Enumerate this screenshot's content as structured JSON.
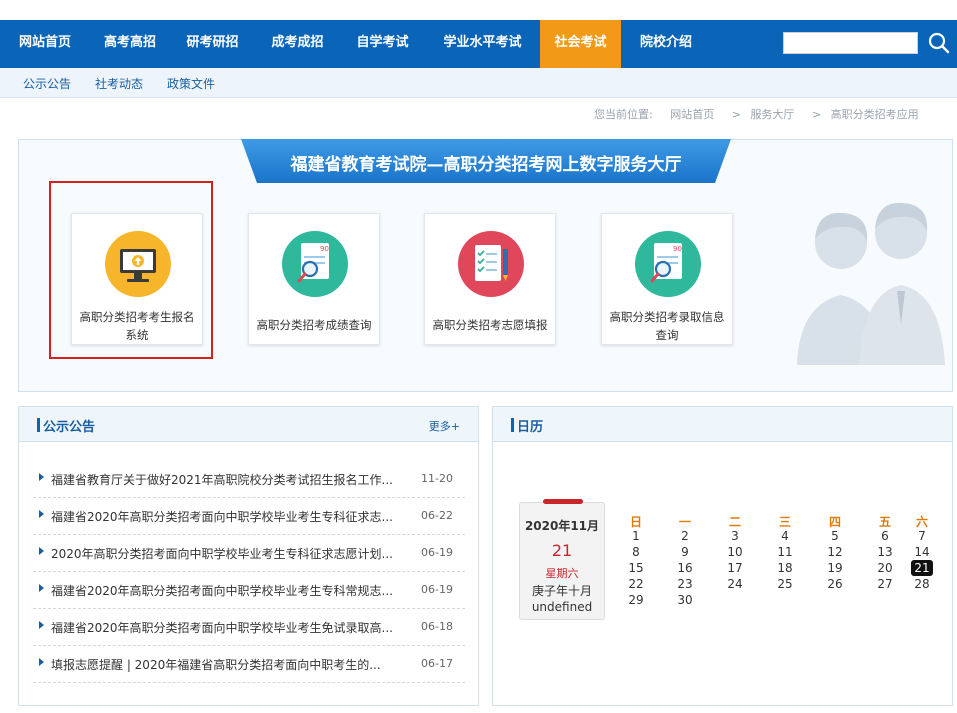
{
  "nav": {
    "items": [
      {
        "label": "网站首页"
      },
      {
        "label": "高考高招"
      },
      {
        "label": "研考研招"
      },
      {
        "label": "成考成招"
      },
      {
        "label": "自学考试"
      },
      {
        "label": "学业水平考试"
      },
      {
        "label": "社会考试"
      },
      {
        "label": "院校介绍"
      }
    ],
    "active_index": 6,
    "search_value": ""
  },
  "subnav": {
    "items": [
      {
        "label": "公示公告"
      },
      {
        "label": "社考动态"
      },
      {
        "label": "政策文件"
      }
    ]
  },
  "breadcrumb": {
    "prefix": "您当前位置:",
    "items": [
      "网站首页",
      "服务大厅",
      "高职分类招考应用"
    ],
    "separator": ">"
  },
  "hall": {
    "title": "福建省教育考试院—高职分类招考网上数字服务大厅",
    "services": [
      {
        "label": "高职分类招考考生报名系统",
        "icon": "computer-upload-icon",
        "color": "#f7b52c"
      },
      {
        "label": "高职分类招考成绩查询",
        "icon": "score-search-icon",
        "color": "#2fb89b"
      },
      {
        "label": "高职分类招考志愿填报",
        "icon": "checklist-pencil-icon",
        "color": "#e0475a"
      },
      {
        "label": "高职分类招考录取信息查询",
        "icon": "admission-search-icon",
        "color": "#2fb89b"
      }
    ]
  },
  "announcements": {
    "title": "公示公告",
    "more": "更多+",
    "items": [
      {
        "title": "福建省教育厅关于做好2021年高职院校分类考试招生报名工作...",
        "date": "11-20"
      },
      {
        "title": "福建省2020年高职分类招考面向中职学校毕业考生专科征求志...",
        "date": "06-22"
      },
      {
        "title": "2020年高职分类招考面向中职学校毕业考生专科征求志愿计划...",
        "date": "06-19"
      },
      {
        "title": "福建省2020年高职分类招考面向中职学校毕业考生专科常规志...",
        "date": "06-19"
      },
      {
        "title": "福建省2020年高职分类招考面向中职学校毕业考生免试录取高...",
        "date": "06-18"
      },
      {
        "title": "填报志愿提醒 | 2020年福建省高职分类招考面向中职考生的...",
        "date": "06-17"
      }
    ]
  },
  "calendar": {
    "title": "日历",
    "card": {
      "year_month": "2020年11月",
      "day": "21",
      "weekday": "星期六",
      "lunar": "庚子年十月",
      "extra": "undefined"
    },
    "weekdays": [
      "日",
      "一",
      "二",
      "三",
      "四",
      "五",
      "六"
    ],
    "first_weekday": 0,
    "days_in_month": 30,
    "today": 21
  },
  "colors": {
    "primary": "#0a65b8",
    "active_tab": "#f29a17",
    "highlight_border": "#d6201d",
    "weekday_header": "#e07b0a",
    "card_red": "#c9252b"
  }
}
